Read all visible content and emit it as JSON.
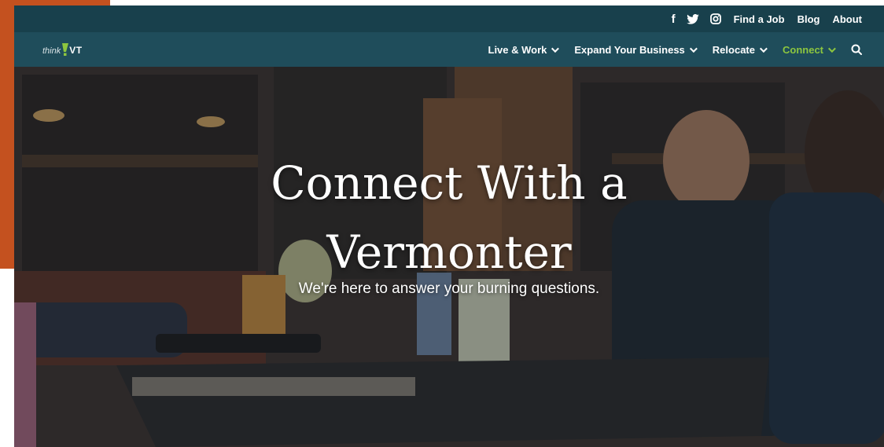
{
  "topbar": {
    "social": [
      {
        "name": "facebook-icon",
        "glyph": "f"
      },
      {
        "name": "twitter-icon"
      },
      {
        "name": "instagram-icon"
      }
    ],
    "links": [
      "Find a Job",
      "Blog",
      "About"
    ]
  },
  "nav": {
    "logo": {
      "think": "think",
      "vt": "VT"
    },
    "items": [
      {
        "label": "Live & Work",
        "active": false
      },
      {
        "label": "Expand Your Business",
        "active": false
      },
      {
        "label": "Relocate",
        "active": false
      },
      {
        "label": "Connect",
        "active": true
      }
    ],
    "search_icon": "search-icon"
  },
  "hero": {
    "title_line1": "Connect With a",
    "title_line2": "Vermonter",
    "subtitle": "We're here to answer your burning questions."
  },
  "colors": {
    "topbar": "#18404c",
    "nav": "#1f4d5b",
    "accent": "#8dc63f",
    "orange": "#c4511f"
  }
}
